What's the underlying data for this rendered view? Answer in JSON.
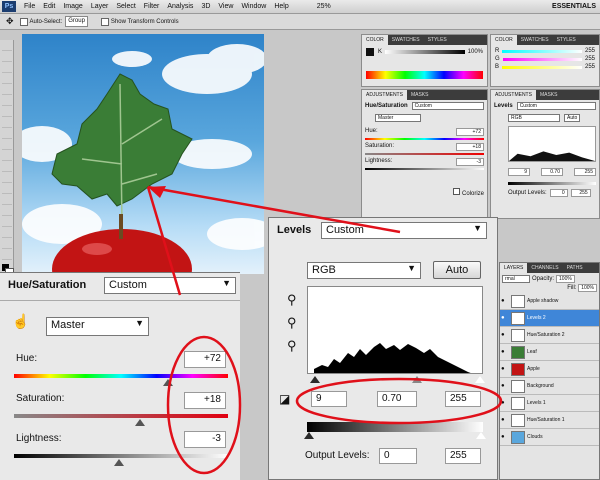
{
  "menu": {
    "items": [
      "File",
      "Edit",
      "Image",
      "Layer",
      "Select",
      "Filter",
      "Analysis",
      "3D",
      "View",
      "Window",
      "Help"
    ],
    "zoom": "25%",
    "workspace": "ESSENTIALS"
  },
  "options": {
    "auto_select": "Auto-Select:",
    "auto_select_value": "Group",
    "transform": "Show Transform Controls"
  },
  "mini_color_left": {
    "tabs": [
      "COLOR",
      "SWATCHES",
      "STYLES"
    ],
    "k_label": "K",
    "k_value": "100",
    "percent": "%"
  },
  "mini_color_right": {
    "tabs": [
      "COLOR",
      "SWATCHES",
      "STYLES"
    ],
    "r_label": "R",
    "r_value": "255",
    "g_label": "G",
    "g_value": "255",
    "b_label": "B",
    "b_value": "255"
  },
  "mini_adj_left": {
    "tabs": [
      "ADJUSTMENTS",
      "MASKS"
    ],
    "title": "Hue/Saturation",
    "preset": "Custom",
    "channel": "Master",
    "hue_label": "Hue:",
    "hue_value": "+72",
    "sat_label": "Saturation:",
    "sat_value": "+18",
    "light_label": "Lightness:",
    "light_value": "-3",
    "colorize": "Colorize"
  },
  "mini_adj_right": {
    "tabs": [
      "ADJUSTMENTS",
      "MASKS"
    ],
    "title": "Levels",
    "preset": "Custom",
    "channel": "RGB",
    "auto": "Auto",
    "in_black": "9",
    "in_mid": "0.70",
    "in_white": "255",
    "out_label": "Output Levels:",
    "out_black": "0",
    "out_white": "255"
  },
  "hue_sat": {
    "title": "Hue/Saturation",
    "preset": "Custom",
    "channel": "Master",
    "hue_label": "Hue:",
    "hue_value": "+72",
    "hue_fraction": 0.72,
    "sat_label": "Saturation:",
    "sat_value": "+18",
    "sat_fraction": 0.59,
    "light_label": "Lightness:",
    "light_value": "-3",
    "light_fraction": 0.49
  },
  "levels": {
    "title": "Levels",
    "preset": "Custom",
    "channel": "RGB",
    "auto": "Auto",
    "in_black": "9",
    "in_mid": "0.70",
    "in_white": "255",
    "out_label": "Output Levels:",
    "out_black": "0",
    "out_white": "255"
  },
  "layers": {
    "tabs": [
      "LAYERS",
      "CHANNELS",
      "PATHS"
    ],
    "mode": "rmal",
    "opacity_label": "Opacity:",
    "opacity": "100%",
    "fill_label": "Fill:",
    "fill": "100%",
    "rows": [
      "Apple shadow",
      "Levels 2",
      "Hue/Saturation 2",
      "Leaf",
      "Apple",
      "Background",
      "Levels 1",
      "Hue/Saturation 1",
      "Clouds"
    ]
  },
  "colors": {
    "annotation": "#e0101a",
    "selection": "#3f86d8"
  }
}
